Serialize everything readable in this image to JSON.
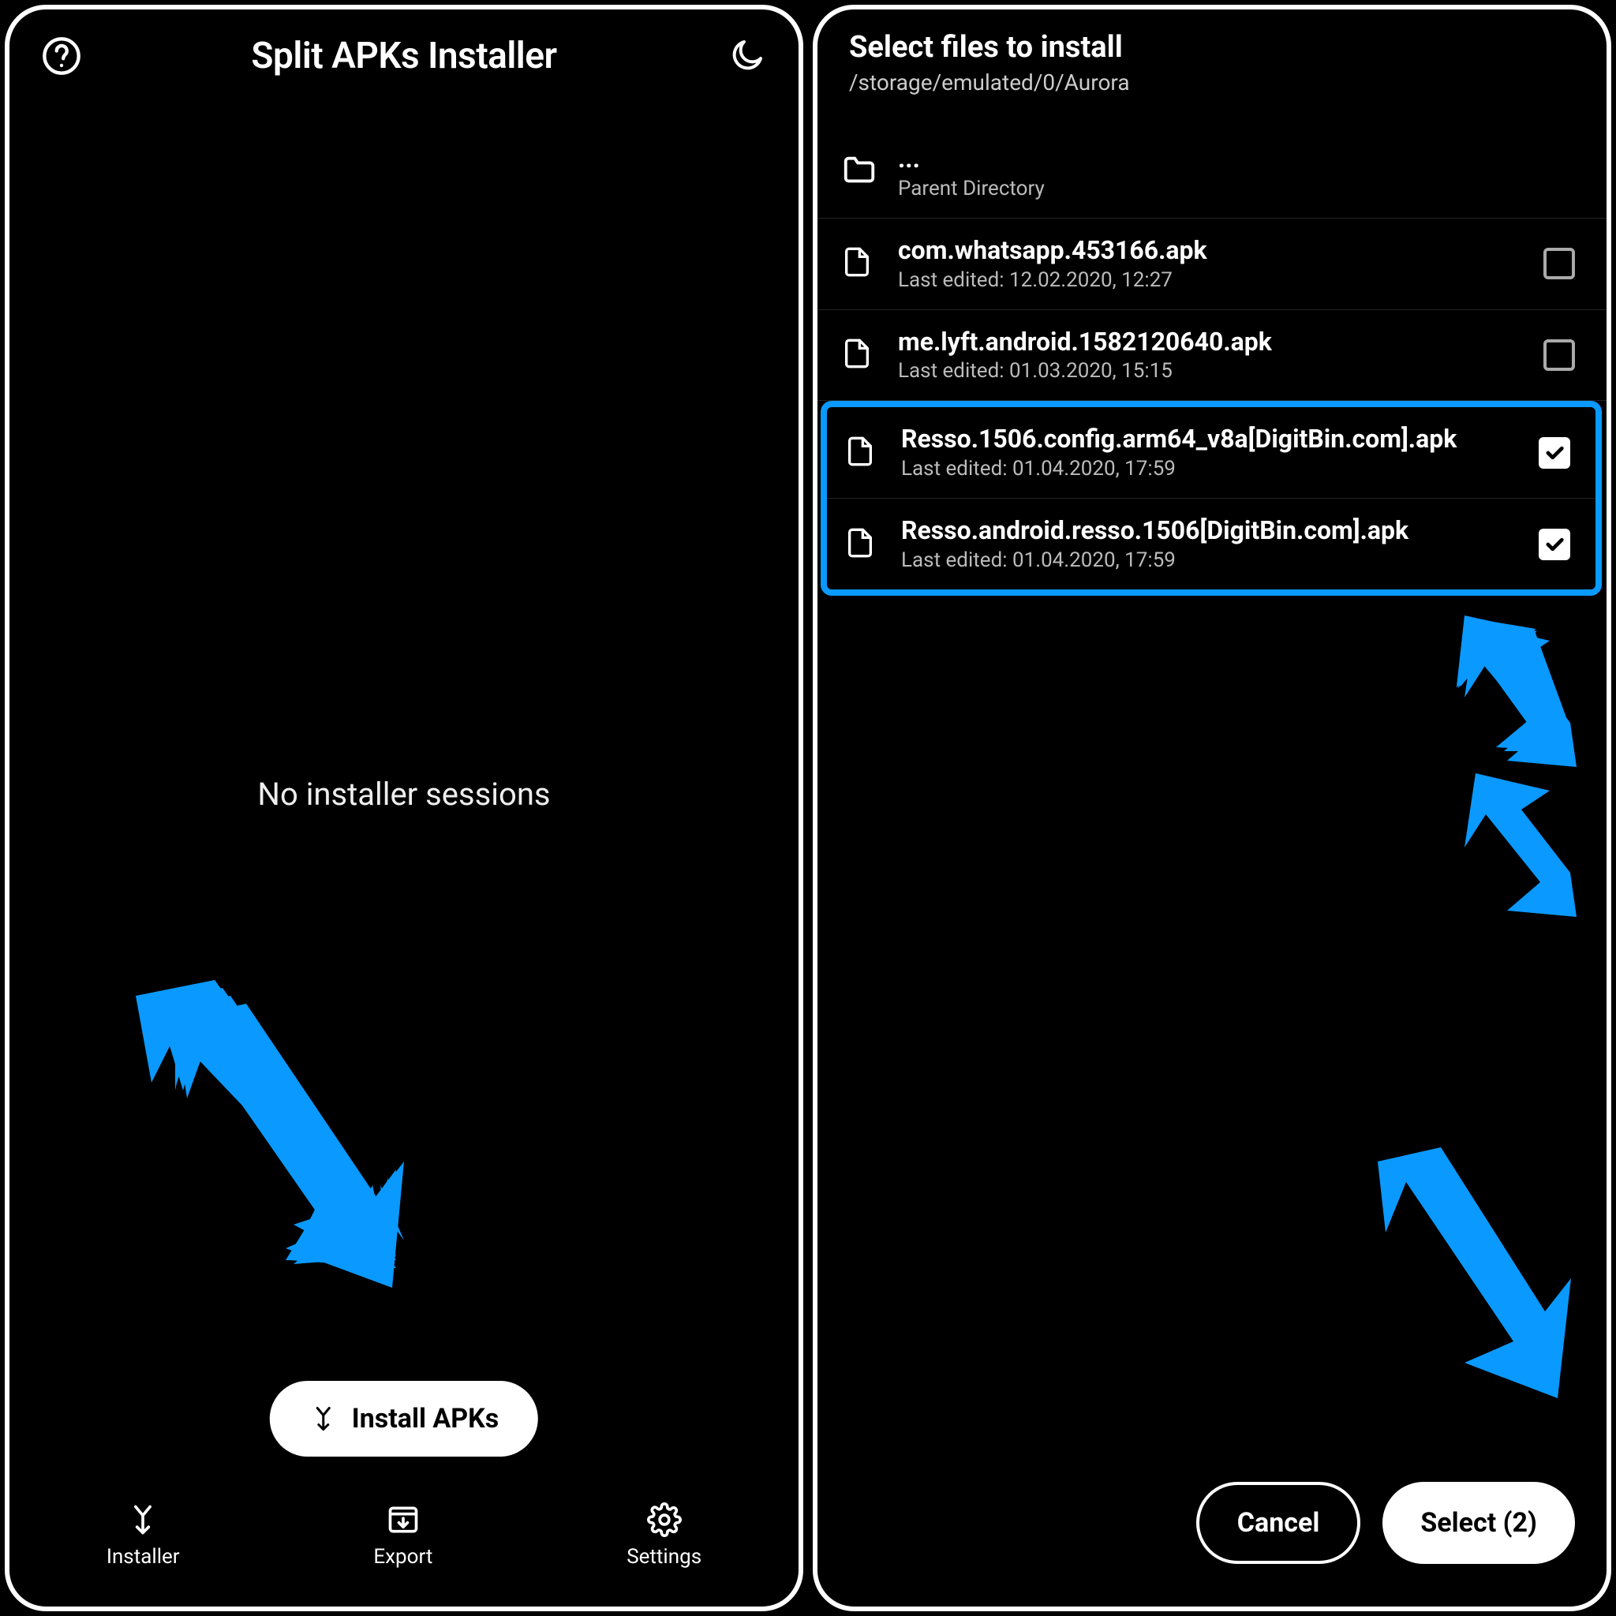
{
  "left": {
    "title": "Split APKs Installer",
    "empty_message": "No installer sessions",
    "install_button": "Install APKs",
    "nav": {
      "installer": "Installer",
      "export": "Export",
      "settings": "Settings"
    }
  },
  "right": {
    "title": "Select files to install",
    "path": "/storage/emulated/0/Aurora",
    "parent_label_top": "...",
    "parent_label": "Parent Directory",
    "files": [
      {
        "name": "com.whatsapp.453166.apk",
        "subtitle": "Last edited: 12.02.2020, 12:27",
        "checked": false
      },
      {
        "name": "me.lyft.android.1582120640.apk",
        "subtitle": "Last edited: 01.03.2020, 15:15",
        "checked": false
      },
      {
        "name": "Resso.1506.config.arm64_v8a[DigitBin.com].apk",
        "subtitle": "Last edited: 01.04.2020, 17:59",
        "checked": true
      },
      {
        "name": "Resso.android.resso.1506[DigitBin.com].apk",
        "subtitle": "Last edited: 01.04.2020, 17:59",
        "checked": true
      }
    ],
    "cancel": "Cancel",
    "select": "Select (2)"
  },
  "colors": {
    "accent_arrow": "#0a99ff",
    "highlight_border": "#0a99ff"
  }
}
